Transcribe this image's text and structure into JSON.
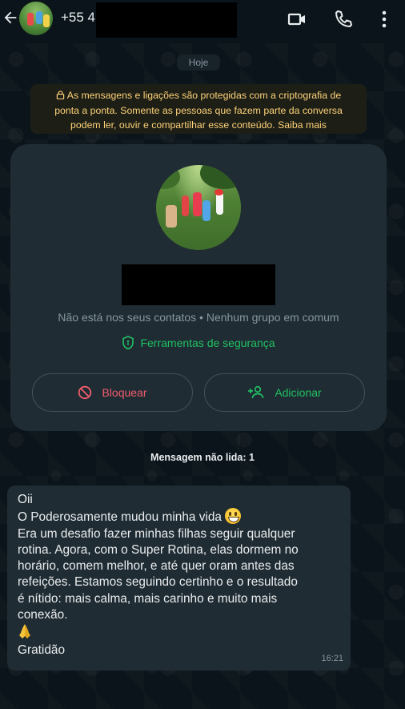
{
  "header": {
    "contact_number": "+55 4",
    "icons": [
      "back-arrow-icon",
      "video-call-icon",
      "phone-icon",
      "more-vertical-icon"
    ]
  },
  "chat": {
    "date_label": "Hoje",
    "encryption_notice": {
      "line1": "As mensagens e ligações são protegidas com a criptografia de",
      "line2": "ponta a ponta. Somente as pessoas que fazem parte da conversa",
      "line3": "podem ler, ouvir e compartilhar esse conteúdo. Saiba mais"
    },
    "contact_card": {
      "not_in_contacts": "Não está nos seus contatos • Nenhum grupo em comum",
      "security_tools": "Ferramentas de segurança",
      "block_label": "Bloquear",
      "add_label": "Adicionar"
    },
    "unread_label": "Mensagem não lida: 1",
    "message": {
      "lines": [
        "Oii",
        "O Poderosamente mudou minha vida",
        "Era um desafio fazer minhas filhas seguir qualquer",
        "rotina. Agora, com o Super Rotina, elas dormem no",
        "horário, comem melhor, e até quer oram antes das",
        "refeições. Estamos seguindo certinho e o resultado",
        "é nítido: mais calma, mais carinho e muito mais",
        "conexão.",
        "Gratidão"
      ],
      "time": "16:21"
    }
  },
  "colors": {
    "background": "#0b141a",
    "bubble": "#202c33",
    "card": "#1f2c33",
    "accent_green": "#21c063",
    "danger_red": "#f15c6d",
    "notice_yellow": "#ffd279"
  }
}
